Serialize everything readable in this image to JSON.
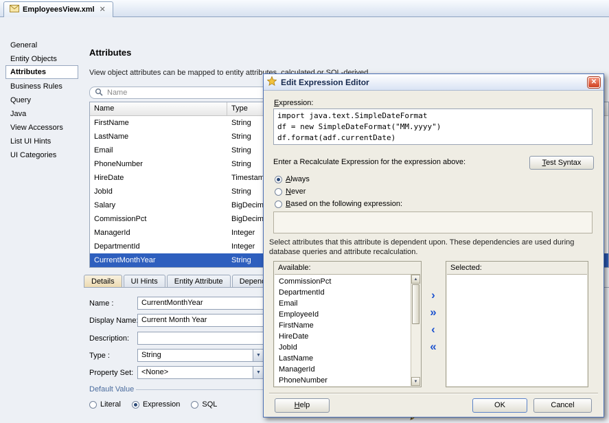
{
  "tab_bar": {
    "tab_label": "EmployeesView.xml"
  },
  "sidebar": {
    "items": [
      "General",
      "Entity Objects",
      "Attributes",
      "Business Rules",
      "Query",
      "Java",
      "View Accessors",
      "List UI Hints",
      "UI Categories"
    ]
  },
  "main": {
    "title": "Attributes",
    "description": "View object attributes can be mapped to entity attributes, calculated or SQL-derived",
    "search_placeholder": "Name",
    "table": {
      "columns": [
        "Name",
        "Type"
      ],
      "rows": [
        {
          "name": "FirstName",
          "type": "String"
        },
        {
          "name": "LastName",
          "type": "String"
        },
        {
          "name": "Email",
          "type": "String"
        },
        {
          "name": "PhoneNumber",
          "type": "String"
        },
        {
          "name": "HireDate",
          "type": "Timestamp"
        },
        {
          "name": "JobId",
          "type": "String"
        },
        {
          "name": "Salary",
          "type": "BigDecimal"
        },
        {
          "name": "CommissionPct",
          "type": "BigDecimal"
        },
        {
          "name": "ManagerId",
          "type": "Integer"
        },
        {
          "name": "DepartmentId",
          "type": "Integer"
        },
        {
          "name": "CurrentMonthYear",
          "type": "String"
        }
      ],
      "selected_row": "CurrentMonthYear"
    },
    "detail_tabs": [
      "Details",
      "UI Hints",
      "Entity Attribute",
      "Dependenc"
    ],
    "form": {
      "name_label": "Name :",
      "name_value": "CurrentMonthYear",
      "display_name_label": "Display Name:",
      "display_name_value": "Current Month Year",
      "description_label": "Description:",
      "description_value": "",
      "type_label": "Type :",
      "type_value": "String",
      "property_set_label": "Property Set:",
      "property_set_value": "<None>",
      "default_value_label": "Default Value",
      "radio_literal": "Literal",
      "radio_expression": "Expression",
      "radio_sql": "SQL"
    }
  },
  "dialog": {
    "title": "Edit Expression Editor",
    "expression_label": "Expression:",
    "expression_code": "import java.text.SimpleDateFormat\ndf = new SimpleDateFormat(\"MM.yyyy\")\ndf.format(adf.currentDate)",
    "recalculate_label": "Enter a Recalculate Expression for the expression above:",
    "test_syntax_button": "Test Syntax",
    "radio_always": "Always",
    "radio_never": "Never",
    "radio_based": "Based on the following expression:",
    "dependency_note": "Select attributes that this attribute is dependent upon. These dependencies are used during database queries and attribute recalculation.",
    "available_label": "Available:",
    "selected_label": "Selected:",
    "available_items": [
      "CommissionPct",
      "DepartmentId",
      "Email",
      "EmployeeId",
      "FirstName",
      "HireDate",
      "JobId",
      "LastName",
      "ManagerId",
      "PhoneNumber"
    ],
    "shuttle": {
      "right": "›",
      "right_all": "»",
      "left": "‹",
      "left_all": "«"
    },
    "help_button": "Help",
    "ok_button": "OK",
    "cancel_button": "Cancel"
  }
}
